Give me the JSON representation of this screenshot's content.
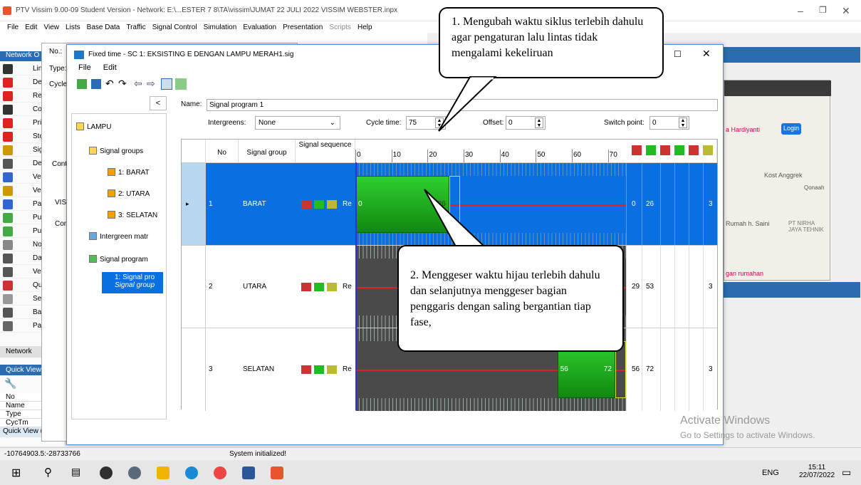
{
  "app": {
    "title": "PTV Vissim 9.00-09 Student Version - Network: E:\\...ESTER 7 8\\TA\\vissim\\JUMAT 22 JULI 2022 VISSIM WEBSTER.inpx",
    "menu": [
      "File",
      "Edit",
      "View",
      "Lists",
      "Base Data",
      "Traffic",
      "Signal Control",
      "Simulation",
      "Evaluation",
      "Presentation",
      "Scripts",
      "Help"
    ]
  },
  "network_objects": {
    "header": "Network O",
    "items": [
      "Lin",
      "De",
      "Re",
      "Co",
      "Pri",
      "Sto",
      "Sig",
      "De",
      "Veh",
      "Veh",
      "Par",
      "Pub",
      "Pub",
      "No",
      "Dat",
      "Veh",
      "Qu",
      "Sec",
      "Bac",
      "Pav"
    ],
    "footer": "Network"
  },
  "quick_view": {
    "header": "Quick View",
    "footer": "Quick View (Sign",
    "rows": [
      "No",
      "Name",
      "Type",
      "CycTm"
    ]
  },
  "bg_window": {
    "label_no": "No.:",
    "label_type": "Type:",
    "label_cycle": "Cycle",
    "label_cont": "Cont",
    "label_viss": "VISS",
    "label_con": "Con"
  },
  "dialog": {
    "title": "Fixed time - SC 1: EKSISTING E DENGAN LAMPU MERAH1.sig",
    "menu": [
      "File",
      "Edit"
    ],
    "name_label": "Name:",
    "name_value": "Signal program 1",
    "intergreens_label": "Intergreens:",
    "intergreens_value": "None",
    "cycle_label": "Cycle time:",
    "cycle_value": "75",
    "offset_label": "Offset:",
    "offset_value": "0",
    "switch_label": "Switch point:",
    "switch_value": "0",
    "collapse_btn": "<",
    "tree": {
      "root": "LAMPU",
      "signal_groups": "Signal groups",
      "groups": [
        "1: BARAT",
        "2: UTARA",
        "3: SELATAN"
      ],
      "intergreen": "Intergreen matr",
      "signal_program": "Signal program",
      "program_item_1": "1: Signal pro",
      "program_item_2": "Signal group"
    },
    "grid": {
      "col_no": "No",
      "col_group": "Signal group",
      "col_seq": "Signal sequence",
      "timeline_ticks": [
        "0",
        "10",
        "20",
        "30",
        "40",
        "50",
        "60",
        "70"
      ],
      "rows": [
        {
          "no": "1",
          "group": "BARAT",
          "seq": "Re",
          "green_start": 0,
          "green_end": 26,
          "c1": "0",
          "c2": "26",
          "c3": "3",
          "selected": true
        },
        {
          "no": "2",
          "group": "UTARA",
          "seq": "Re",
          "green_start": 29,
          "green_end": 53,
          "c1": "29",
          "c2": "53",
          "c3": "3",
          "selected": false
        },
        {
          "no": "3",
          "group": "SELATAN",
          "seq": "Re",
          "green_start": 56,
          "green_end": 72,
          "c1": "56",
          "c2": "72",
          "c3": "3",
          "selected": false
        }
      ]
    }
  },
  "callouts": {
    "one": "1. Mengubah waktu siklus terlebih dahulu agar pengaturan lalu lintas tidak mengalami kekeliruan",
    "two": "2. Menggeser waktu hijau terlebih dahulu dan selanjutnya menggeser bagian penggaris dengan saling bergantian tiap fase,"
  },
  "map": {
    "labels": [
      "a Hardiyanti",
      "Kost Anggrek",
      "Qonaah",
      "Rumah h. Saini",
      "PT NIRHA JAYA TEHNIK",
      "gan rumahan"
    ],
    "login": "Login"
  },
  "watermark": {
    "line1": "Activate Windows",
    "line2": "Go to Settings to activate Windows."
  },
  "status": {
    "coords": "-10764903.5:-28733766",
    "message": "System initialized!"
  },
  "tray": {
    "lang": "ENG",
    "time": "15:11",
    "date": "22/07/2022"
  }
}
